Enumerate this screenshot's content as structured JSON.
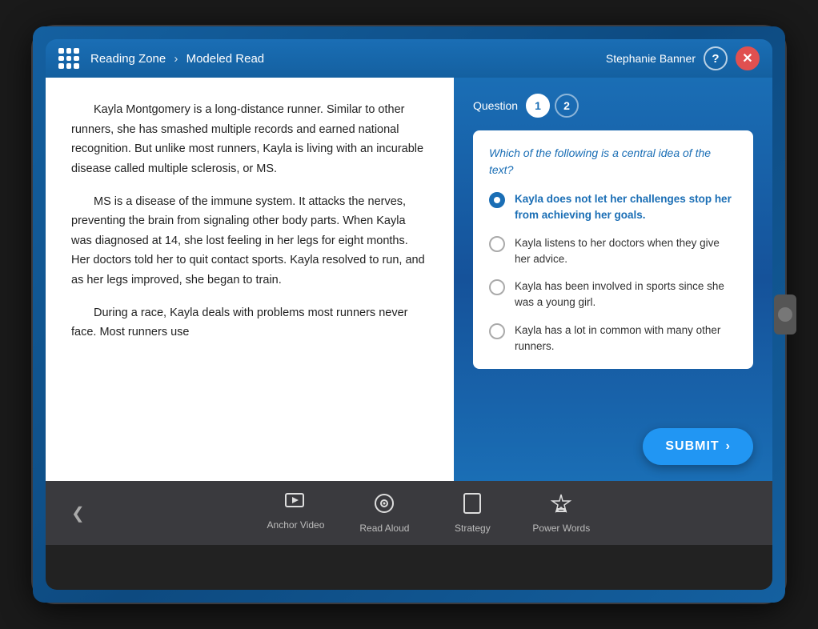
{
  "header": {
    "app_icon_label": "grid-icon",
    "breadcrumb_part1": "Reading Zone",
    "breadcrumb_separator": "›",
    "breadcrumb_part2": "Modeled Read",
    "username": "Stephanie Banner",
    "help_label": "?",
    "close_label": "✕"
  },
  "reading": {
    "paragraphs": [
      "Kayla Montgomery is a long-distance runner. Similar to other runners, she has smashed multiple records and earned national recognition. But unlike most runners, Kayla is living with an incurable disease called multiple sclerosis, or MS.",
      "MS is a disease of the immune system. It attacks the nerves, preventing the brain from signaling other body parts. When Kayla was diagnosed at 14, she lost feeling in her legs for eight months. Her doctors told her to quit contact sports. Kayla resolved to run, and as her legs improved, she began to train.",
      "During a race, Kayla deals with problems most runners never face. Most runners use"
    ]
  },
  "question_panel": {
    "question_label": "Question",
    "tab1": "1",
    "tab2": "2",
    "question_text": "Which of the following is a central idea of the text?",
    "answers": [
      {
        "id": "a",
        "text": "Kayla does not let her challenges stop her from achieving her goals.",
        "selected": true
      },
      {
        "id": "b",
        "text": "Kayla listens to her doctors when they give her advice.",
        "selected": false
      },
      {
        "id": "c",
        "text": "Kayla has been involved in sports since she was a young girl.",
        "selected": false
      },
      {
        "id": "d",
        "text": "Kayla has a lot in common with many other runners.",
        "selected": false
      }
    ],
    "submit_label": "SUBMIT",
    "submit_arrow": "›"
  },
  "toolbar": {
    "chevron": "❮",
    "items": [
      {
        "id": "anchor-video",
        "icon": "▶",
        "label": "Anchor Video"
      },
      {
        "id": "read-aloud",
        "icon": "◎",
        "label": "Read Aloud"
      },
      {
        "id": "strategy",
        "icon": "⚑",
        "label": "Strategy"
      },
      {
        "id": "power-words",
        "icon": "⚡",
        "label": "Power Words"
      }
    ]
  }
}
